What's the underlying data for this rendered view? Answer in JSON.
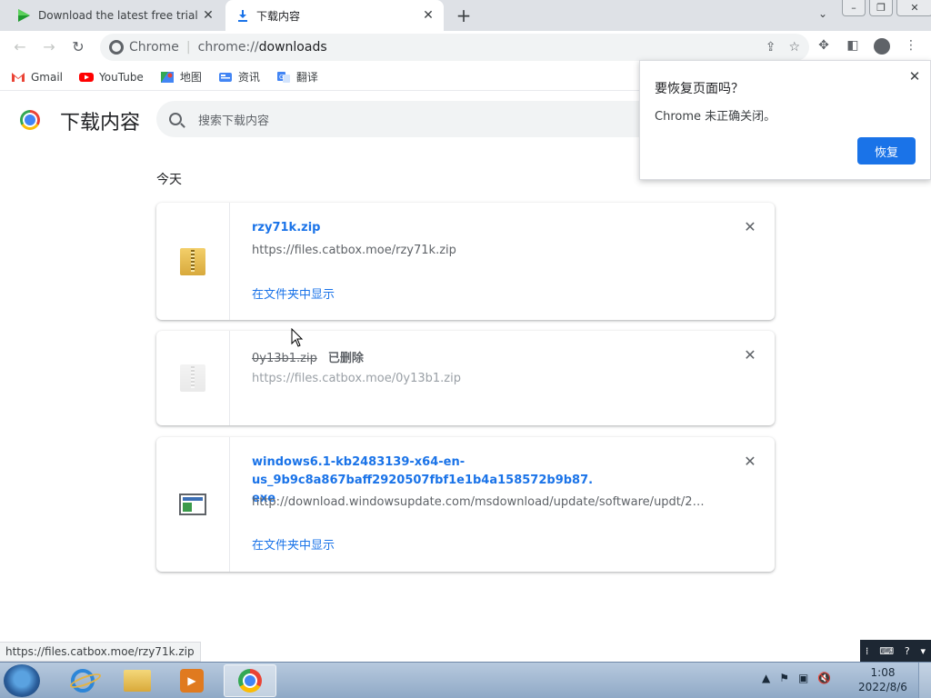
{
  "tabs": [
    {
      "title": "Download the latest free trial v",
      "icon": "play-triangle-icon",
      "close": "✕"
    },
    {
      "title": "下载内容",
      "icon": "download-icon",
      "close": "✕"
    }
  ],
  "omnibox": {
    "site_chip": "Chrome",
    "url_scheme": "chrome://",
    "url_host": "downloads"
  },
  "bookmarks": [
    {
      "label": "Gmail",
      "icon": "gmail-icon"
    },
    {
      "label": "YouTube",
      "icon": "youtube-icon"
    },
    {
      "label": "地图",
      "icon": "maps-icon"
    },
    {
      "label": "资讯",
      "icon": "news-icon"
    },
    {
      "label": "翻译",
      "icon": "translate-icon"
    }
  ],
  "page": {
    "title": "下载内容",
    "search_placeholder": "搜索下载内容",
    "section_label": "今天"
  },
  "downloads": [
    {
      "name": "rzy71k.zip",
      "url": "https://files.catbox.moe/rzy71k.zip",
      "action": "在文件夹中显示"
    },
    {
      "name": "0y13b1.zip",
      "status": "已删除",
      "url": "https://files.catbox.moe/0y13b1.zip"
    },
    {
      "name_line1": "windows6.1-kb2483139-x64-en-us_9b9c8a867baff2920507fbf1e1b4a158572b9b87.",
      "name_line2": "exe",
      "url": "http://download.windowsupdate.com/msdownload/update/software/updt/2011/02/...",
      "action": "在文件夹中显示"
    }
  ],
  "popup": {
    "title": "要恢复页面吗？",
    "message": "Chrome 未正确关闭。",
    "button": "恢复"
  },
  "status_bubble": "https://files.catbox.moe/rzy71k.zip",
  "clock": {
    "time": "1:08",
    "date": "2022/8/6"
  },
  "colors": {
    "accent": "#1a73e8",
    "tabstrip": "#dee1e6"
  }
}
